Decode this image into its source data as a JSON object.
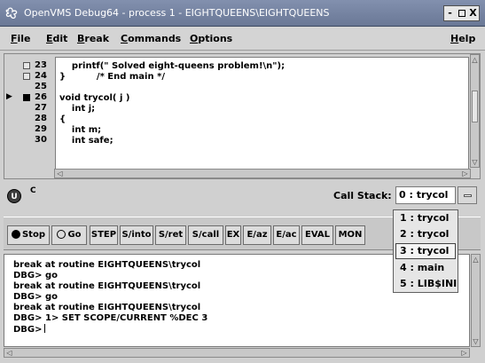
{
  "window": {
    "title": "OpenVMS Debug64 - process 1 - EIGHTQUEENS\\EIGHTQUEENS",
    "minimize": "-",
    "close": "X"
  },
  "menu": [
    {
      "label": "File",
      "underline": "F",
      "rest": "ile"
    },
    {
      "label": "Edit",
      "underline": "E",
      "rest": "dit"
    },
    {
      "label": "Break",
      "underline": "B",
      "rest": "reak"
    },
    {
      "label": "Commands",
      "underline": "C",
      "rest": "ommands"
    },
    {
      "label": "Options",
      "underline": "O",
      "rest": "ptions"
    },
    {
      "label": "Help",
      "underline": "H",
      "rest": "elp"
    }
  ],
  "source": {
    "lines": [
      {
        "num": "23",
        "code": "    printf(\" Solved eight-queens problem!\\n\");",
        "marker": "",
        "has_checkbox": true,
        "breakpoint": false
      },
      {
        "num": "24",
        "code": "}          /* End main */",
        "marker": "",
        "has_checkbox": true,
        "breakpoint": false
      },
      {
        "num": "25",
        "code": "",
        "marker": "",
        "has_checkbox": false,
        "breakpoint": false
      },
      {
        "num": "26",
        "code": "void trycol( j )",
        "marker": "▶",
        "has_checkbox": true,
        "breakpoint": true
      },
      {
        "num": "27",
        "code": "    int j;",
        "marker": "",
        "has_checkbox": false,
        "breakpoint": false
      },
      {
        "num": "28",
        "code": "{",
        "marker": "",
        "has_checkbox": false,
        "breakpoint": false
      },
      {
        "num": "29",
        "code": "    int m;",
        "marker": "",
        "has_checkbox": false,
        "breakpoint": false
      },
      {
        "num": "30",
        "code": "    int safe;",
        "marker": "",
        "has_checkbox": false,
        "breakpoint": false
      }
    ]
  },
  "status": {
    "indicator": "U",
    "language": "C"
  },
  "call_stack": {
    "label": "Call Stack:",
    "selected": "0 : trycol",
    "options": [
      "1 : trycol",
      "2 : trycol",
      "3 : trycol",
      "4 : main",
      "5 : LIB$INI"
    ],
    "highlighted_index": 2
  },
  "toolbar": {
    "buttons": [
      "Stop",
      "Go",
      "STEP",
      "S/into",
      "S/ret",
      "S/call",
      "EX",
      "E/az",
      "E/ac",
      "EVAL",
      "MON"
    ]
  },
  "output": {
    "lines": [
      "break at routine EIGHTQUEENS\\trycol",
      "DBG> go",
      "break at routine EIGHTQUEENS\\trycol",
      "DBG> go",
      "break at routine EIGHTQUEENS\\trycol",
      "DBG> 1> SET SCOPE/CURRENT %DEC 3",
      "DBG>"
    ]
  }
}
